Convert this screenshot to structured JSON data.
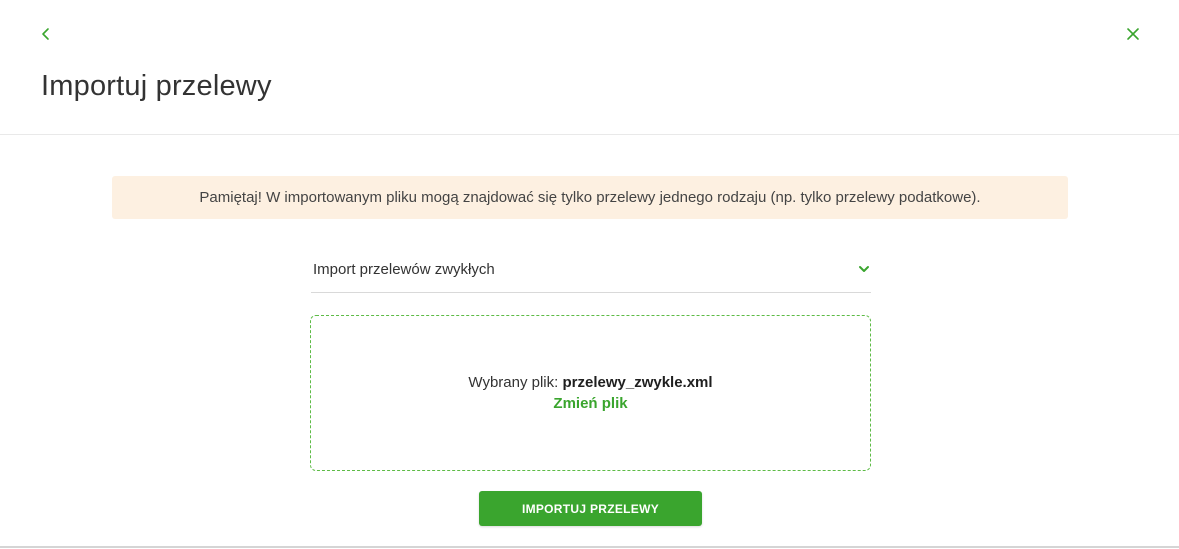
{
  "header": {
    "title": "Importuj przelewy",
    "back_icon": "chevron-left-icon",
    "close_icon": "close-icon"
  },
  "notice": {
    "text": "Pamiętaj! W importowanym pliku mogą znajdować się tylko przelewy jednego rodzaju (np. tylko przelewy podatkowe)."
  },
  "import_type_select": {
    "selected": "Import przelewów zwykłych",
    "icon": "chevron-down-icon"
  },
  "dropzone": {
    "file_label": "Wybrany plik:",
    "file_name": "przelewy_zwykle.xml",
    "change_file_label": "Zmień plik"
  },
  "actions": {
    "import_label": "IMPORTUJ PRZELEWY"
  },
  "colors": {
    "accent": "#3aa52e",
    "notice_background": "#fdf0e1",
    "dropzone_border": "#5dbb46"
  }
}
